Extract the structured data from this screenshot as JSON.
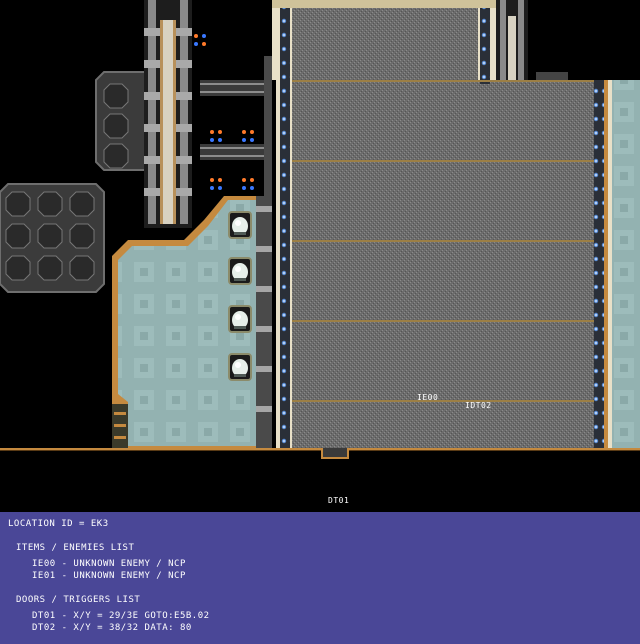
{
  "map": {
    "entity_labels": [
      "IE00",
      "IDT02"
    ],
    "door_label": "DT01",
    "colors": {
      "floor": "#93b2b1",
      "hall": "#707070",
      "trim": "#c58a3f",
      "rim": "#e8e0c8",
      "background": "#000000"
    }
  },
  "panel": {
    "background": "#4a4797",
    "location": "LOCATION ID = EK3",
    "items_heading": "ITEMS / ENEMIES LIST",
    "items": [
      "IE00 - UNKNOWN ENEMY / NCP",
      "IE01 - UNKNOWN ENEMY / NCP"
    ],
    "doors_heading": "DOORS / TRIGGERS LIST",
    "doors": [
      "DT01 - X/Y = 29/3E GOTO:E5B.02",
      "DT02 - X/Y = 38/32 DATA: 80"
    ]
  }
}
